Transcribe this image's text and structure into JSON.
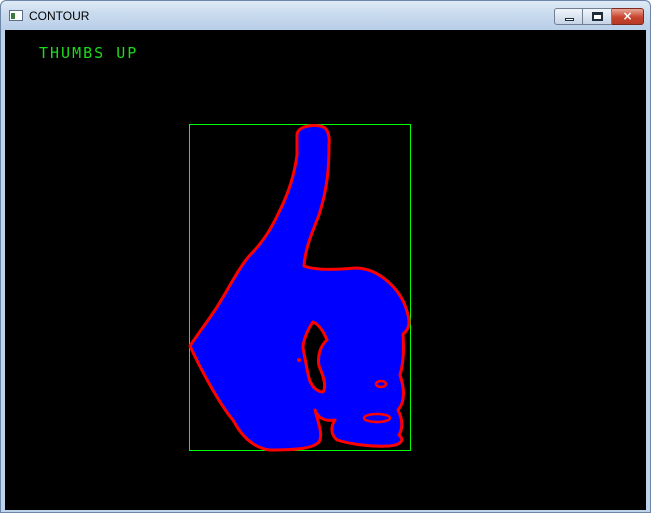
{
  "window": {
    "title": "CONTOUR",
    "controls": {
      "minimize": "minimize",
      "maximize": "maximize",
      "close": "×"
    }
  },
  "canvas": {
    "label": "THUMBS UP",
    "colors": {
      "background": "#000000",
      "fill": "#0000ff",
      "contour": "#ff0000",
      "bounding_box": "#00ff00",
      "label": "#00ff00"
    }
  }
}
